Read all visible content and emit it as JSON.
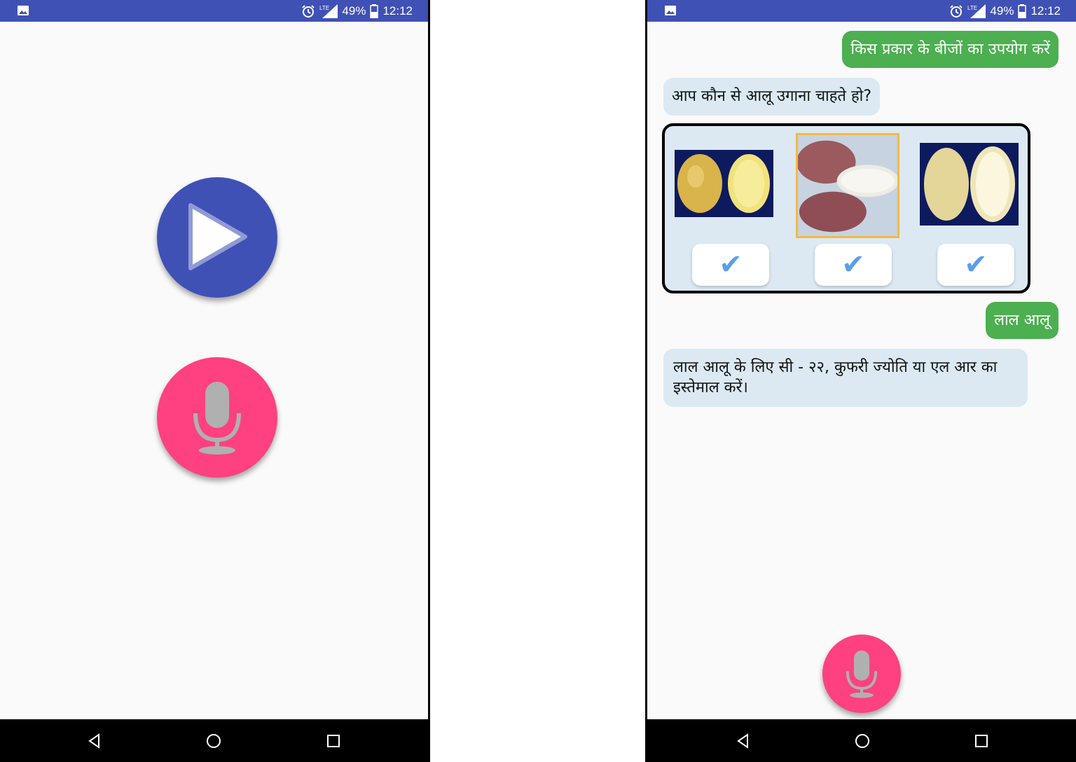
{
  "status": {
    "battery": "49%",
    "time": "12:12",
    "network": "LTE"
  },
  "screen_a": {
    "buttons": [
      "play-icon",
      "mic-icon"
    ]
  },
  "chat": {
    "messages": [
      {
        "from": "user",
        "text": "किस प्रकार के बीजों का उपयोग करें"
      },
      {
        "from": "bot",
        "text": "आप कौन से आलू उगाना चाहते हो?"
      },
      {
        "from": "user",
        "text": "लाल आलू"
      },
      {
        "from": "bot",
        "text": "लाल आलू के लिए सी - २२, कुफरी ज्योति या एल आर का इस्तेमाल करें।"
      }
    ],
    "options": [
      {
        "icon": "checkmark-icon",
        "check": "✔",
        "selected": false
      },
      {
        "icon": "checkmark-icon",
        "check": "✔",
        "selected": true
      },
      {
        "icon": "checkmark-icon",
        "check": "✔",
        "selected": false
      }
    ]
  },
  "colors": {
    "status_bar": "#3f51b5",
    "play_fab": "#3f51b5",
    "mic_fab": "#ff4081",
    "user_bubble": "#4caf50",
    "bot_bubble": "#dce9f3",
    "selected_border": "#f4b942",
    "check": "#5b9fe8"
  }
}
